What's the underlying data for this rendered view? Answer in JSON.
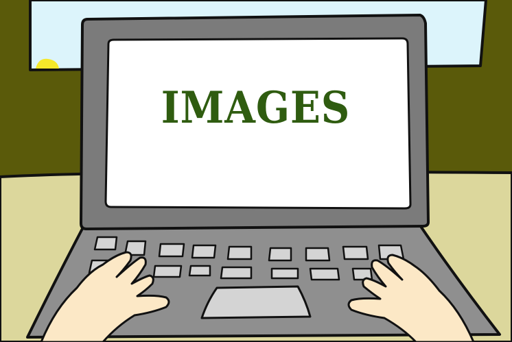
{
  "screen": {
    "text": "IMAGES"
  },
  "colors": {
    "wall": "#5a5a0a",
    "sky": "#dcf4fb",
    "sun": "#f5e82a",
    "desk": "#dcd79c",
    "laptop": "#8f8f8f",
    "bezel": "#7b7b7b",
    "screen": "#ffffff",
    "keys": "#d4d4d4",
    "skin": "#fce8c6",
    "text": "#2f5c10",
    "outline": "#111111"
  },
  "icons": {
    "sun": "sun-icon"
  }
}
